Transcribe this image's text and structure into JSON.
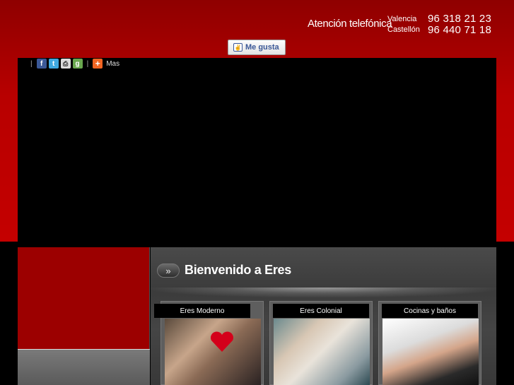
{
  "header": {
    "phone_label": "Atención telefónica",
    "cities": [
      {
        "name": "Valencia",
        "number": "96 318 21 23"
      },
      {
        "name": "Castellón",
        "number": "96 440 71 18"
      }
    ],
    "like_button": "Me gusta"
  },
  "share": {
    "icons": [
      "facebook-icon",
      "twitter-icon",
      "print-icon",
      "google-bookmark-icon",
      "plus-icon"
    ],
    "more_label": "Mas"
  },
  "welcome": {
    "title": "Bienvenido a Eres",
    "arrow": "»"
  },
  "cards": [
    {
      "label": "Eres Moderno"
    },
    {
      "label": "Eres Colonial"
    },
    {
      "label": "Cocinas y baños"
    }
  ],
  "colors": {
    "header_red": "#c40000",
    "side_red": "#9c0000",
    "panel_gray": "#454545"
  }
}
